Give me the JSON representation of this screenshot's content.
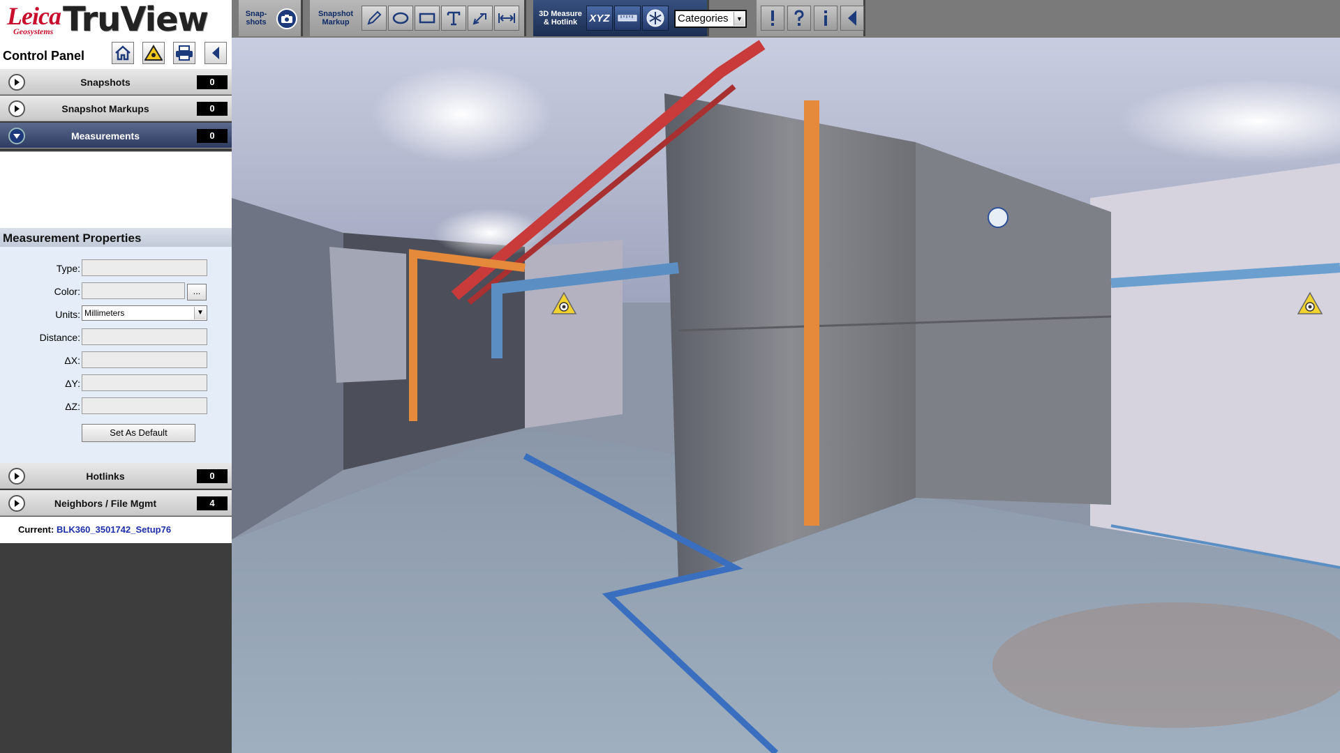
{
  "app": {
    "brand": "Leica",
    "brand_sub": "Geosystems",
    "product": "TruView"
  },
  "control_panel": {
    "title": "Control Panel",
    "sections": {
      "snapshots": {
        "label": "Snapshots",
        "count": "0"
      },
      "snapshot_markups": {
        "label": "Snapshot Markups",
        "count": "0"
      },
      "measurements": {
        "label": "Measurements",
        "count": "0"
      },
      "hotlinks": {
        "label": "Hotlinks",
        "count": "0"
      },
      "neighbors": {
        "label": "Neighbors / File Mgmt",
        "count": "4"
      }
    },
    "measurement_properties": {
      "title": "Measurement Properties",
      "type_label": "Type:",
      "color_label": "Color:",
      "color_button": "...",
      "units_label": "Units:",
      "units_value": "Millimeters",
      "distance_label": "Distance:",
      "dx_label": "ΔX:",
      "dy_label": "ΔY:",
      "dz_label": "ΔZ:",
      "default_button": "Set As Default"
    },
    "current": {
      "label": "Current:",
      "value": "BLK360_3501742_Setup76"
    }
  },
  "toolbar": {
    "snapshots_label_line1": "Snap-",
    "snapshots_label_line2": "shots",
    "markup_label_line1": "Snapshot",
    "markup_label_line2": "Markup",
    "measure_label_line1": "3D Measure",
    "measure_label_line2": "& Hotlink",
    "xyz_label": "XYZ",
    "categories_value": "Categories"
  },
  "icons": [
    "home-icon",
    "warning-icon",
    "print-icon",
    "collapse-left-icon",
    "camera-icon",
    "pen-icon",
    "ellipse-icon",
    "rectangle-icon",
    "text-icon",
    "leader-icon",
    "dimension-icon",
    "ruler-icon",
    "snowflake-icon",
    "exclamation-icon",
    "help-icon",
    "info-icon",
    "collapse-toolbar-icon",
    "scan-position-marker-icon"
  ],
  "colors": {
    "brand_red": "#c8102e",
    "panel_dark": "#3d3d3d",
    "accordion_open": "#2e3b60",
    "props_bg": "#e4edf8",
    "current_value": "#1b2ea8",
    "marker_yellow": "#f2d22e"
  }
}
